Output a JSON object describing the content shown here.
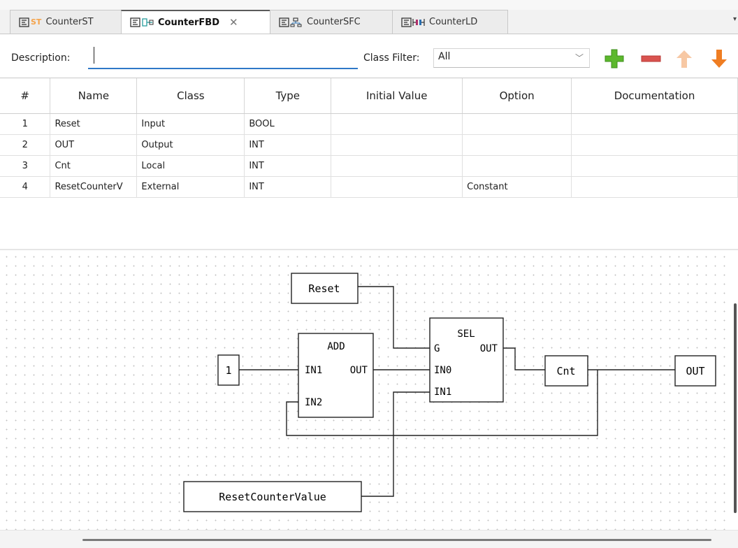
{
  "tabs": [
    {
      "label": "CounterST",
      "badge": "ST",
      "icon": "st-language-icon",
      "active": false
    },
    {
      "label": "CounterFBD",
      "badge": "",
      "icon": "fbd-language-icon",
      "active": true
    },
    {
      "label": "CounterSFC",
      "badge": "",
      "icon": "sfc-language-icon",
      "active": false
    },
    {
      "label": "CounterLD",
      "badge": "",
      "icon": "ld-language-icon",
      "active": false
    }
  ],
  "toolbar": {
    "description_label": "Description:",
    "description_value": "",
    "class_filter_label": "Class Filter:",
    "class_filter_value": "All"
  },
  "table": {
    "columns": [
      "#",
      "Name",
      "Class",
      "Type",
      "Initial Value",
      "Option",
      "Documentation"
    ],
    "rows": [
      {
        "num": "1",
        "name": "Reset",
        "class": "Input",
        "type": "BOOL",
        "initial": "",
        "option": "",
        "doc": ""
      },
      {
        "num": "2",
        "name": "OUT",
        "class": "Output",
        "type": "INT",
        "initial": "",
        "option": "",
        "doc": ""
      },
      {
        "num": "3",
        "name": "Cnt",
        "class": "Local",
        "type": "INT",
        "initial": "",
        "option": "",
        "doc": ""
      },
      {
        "num": "4",
        "name": "ResetCounterV",
        "class": "External",
        "type": "INT",
        "initial": "",
        "option": "Constant",
        "doc": ""
      }
    ]
  },
  "diagram": {
    "reset_var": "Reset",
    "const_one": "1",
    "add_block": {
      "title": "ADD",
      "in1": "IN1",
      "in2": "IN2",
      "out": "OUT"
    },
    "sel_block": {
      "title": "SEL",
      "g": "G",
      "in0": "IN0",
      "in1": "IN1",
      "out": "OUT"
    },
    "cnt_var": "Cnt",
    "out_var": "OUT",
    "reset_counter_var": "ResetCounterValue"
  },
  "colors": {
    "active_tab_border": "#5a5a5a",
    "input_underline": "#2e78c8",
    "add_button": "#5cb82d",
    "remove_button": "#d9534f",
    "move_up_button": "#f7c8a4",
    "move_down_button": "#ef7d22",
    "st_badge": "#f5a34a"
  }
}
